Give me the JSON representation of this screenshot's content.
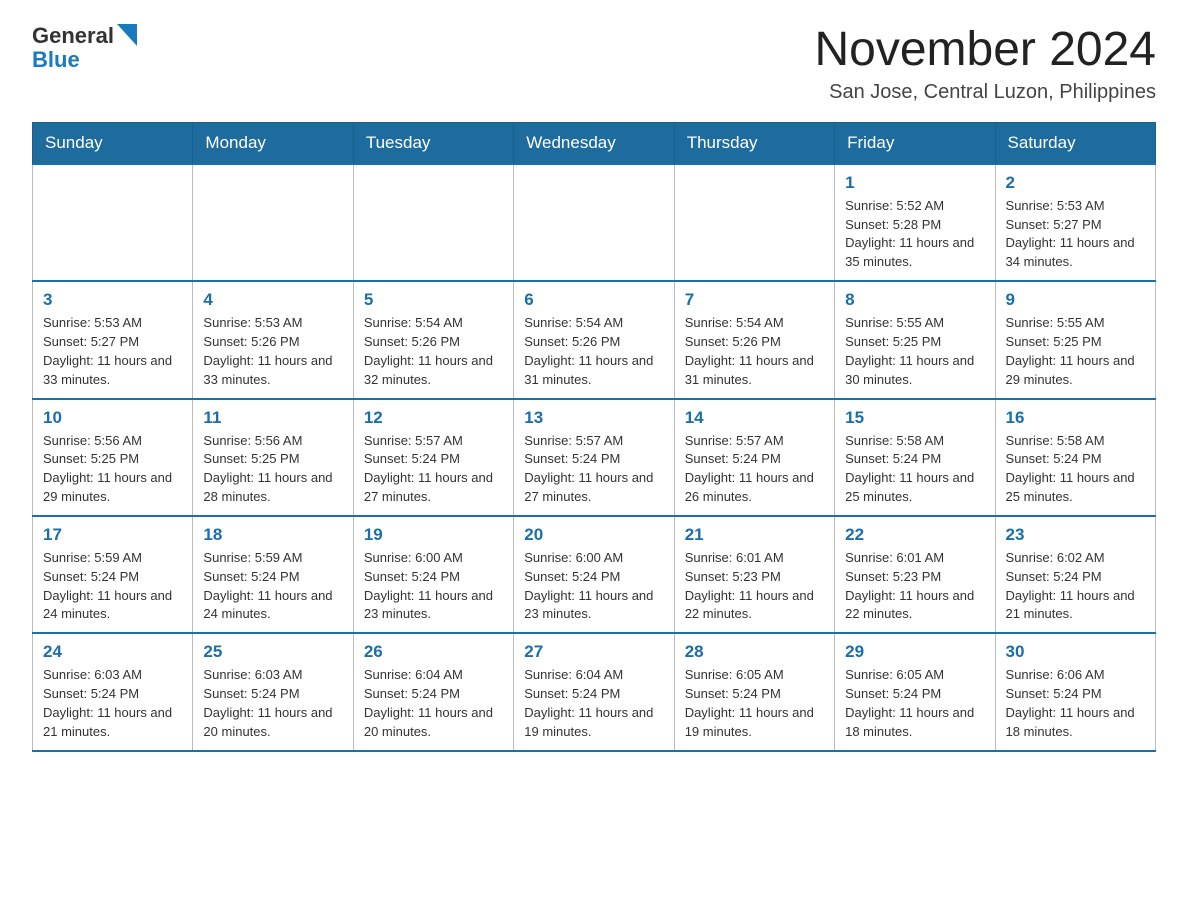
{
  "header": {
    "logo_general": "General",
    "logo_blue": "Blue",
    "month_year": "November 2024",
    "location": "San Jose, Central Luzon, Philippines"
  },
  "weekdays": [
    "Sunday",
    "Monday",
    "Tuesday",
    "Wednesday",
    "Thursday",
    "Friday",
    "Saturday"
  ],
  "weeks": [
    [
      {
        "day": "",
        "info": ""
      },
      {
        "day": "",
        "info": ""
      },
      {
        "day": "",
        "info": ""
      },
      {
        "day": "",
        "info": ""
      },
      {
        "day": "",
        "info": ""
      },
      {
        "day": "1",
        "info": "Sunrise: 5:52 AM\nSunset: 5:28 PM\nDaylight: 11 hours and 35 minutes."
      },
      {
        "day": "2",
        "info": "Sunrise: 5:53 AM\nSunset: 5:27 PM\nDaylight: 11 hours and 34 minutes."
      }
    ],
    [
      {
        "day": "3",
        "info": "Sunrise: 5:53 AM\nSunset: 5:27 PM\nDaylight: 11 hours and 33 minutes."
      },
      {
        "day": "4",
        "info": "Sunrise: 5:53 AM\nSunset: 5:26 PM\nDaylight: 11 hours and 33 minutes."
      },
      {
        "day": "5",
        "info": "Sunrise: 5:54 AM\nSunset: 5:26 PM\nDaylight: 11 hours and 32 minutes."
      },
      {
        "day": "6",
        "info": "Sunrise: 5:54 AM\nSunset: 5:26 PM\nDaylight: 11 hours and 31 minutes."
      },
      {
        "day": "7",
        "info": "Sunrise: 5:54 AM\nSunset: 5:26 PM\nDaylight: 11 hours and 31 minutes."
      },
      {
        "day": "8",
        "info": "Sunrise: 5:55 AM\nSunset: 5:25 PM\nDaylight: 11 hours and 30 minutes."
      },
      {
        "day": "9",
        "info": "Sunrise: 5:55 AM\nSunset: 5:25 PM\nDaylight: 11 hours and 29 minutes."
      }
    ],
    [
      {
        "day": "10",
        "info": "Sunrise: 5:56 AM\nSunset: 5:25 PM\nDaylight: 11 hours and 29 minutes."
      },
      {
        "day": "11",
        "info": "Sunrise: 5:56 AM\nSunset: 5:25 PM\nDaylight: 11 hours and 28 minutes."
      },
      {
        "day": "12",
        "info": "Sunrise: 5:57 AM\nSunset: 5:24 PM\nDaylight: 11 hours and 27 minutes."
      },
      {
        "day": "13",
        "info": "Sunrise: 5:57 AM\nSunset: 5:24 PM\nDaylight: 11 hours and 27 minutes."
      },
      {
        "day": "14",
        "info": "Sunrise: 5:57 AM\nSunset: 5:24 PM\nDaylight: 11 hours and 26 minutes."
      },
      {
        "day": "15",
        "info": "Sunrise: 5:58 AM\nSunset: 5:24 PM\nDaylight: 11 hours and 25 minutes."
      },
      {
        "day": "16",
        "info": "Sunrise: 5:58 AM\nSunset: 5:24 PM\nDaylight: 11 hours and 25 minutes."
      }
    ],
    [
      {
        "day": "17",
        "info": "Sunrise: 5:59 AM\nSunset: 5:24 PM\nDaylight: 11 hours and 24 minutes."
      },
      {
        "day": "18",
        "info": "Sunrise: 5:59 AM\nSunset: 5:24 PM\nDaylight: 11 hours and 24 minutes."
      },
      {
        "day": "19",
        "info": "Sunrise: 6:00 AM\nSunset: 5:24 PM\nDaylight: 11 hours and 23 minutes."
      },
      {
        "day": "20",
        "info": "Sunrise: 6:00 AM\nSunset: 5:24 PM\nDaylight: 11 hours and 23 minutes."
      },
      {
        "day": "21",
        "info": "Sunrise: 6:01 AM\nSunset: 5:23 PM\nDaylight: 11 hours and 22 minutes."
      },
      {
        "day": "22",
        "info": "Sunrise: 6:01 AM\nSunset: 5:23 PM\nDaylight: 11 hours and 22 minutes."
      },
      {
        "day": "23",
        "info": "Sunrise: 6:02 AM\nSunset: 5:24 PM\nDaylight: 11 hours and 21 minutes."
      }
    ],
    [
      {
        "day": "24",
        "info": "Sunrise: 6:03 AM\nSunset: 5:24 PM\nDaylight: 11 hours and 21 minutes."
      },
      {
        "day": "25",
        "info": "Sunrise: 6:03 AM\nSunset: 5:24 PM\nDaylight: 11 hours and 20 minutes."
      },
      {
        "day": "26",
        "info": "Sunrise: 6:04 AM\nSunset: 5:24 PM\nDaylight: 11 hours and 20 minutes."
      },
      {
        "day": "27",
        "info": "Sunrise: 6:04 AM\nSunset: 5:24 PM\nDaylight: 11 hours and 19 minutes."
      },
      {
        "day": "28",
        "info": "Sunrise: 6:05 AM\nSunset: 5:24 PM\nDaylight: 11 hours and 19 minutes."
      },
      {
        "day": "29",
        "info": "Sunrise: 6:05 AM\nSunset: 5:24 PM\nDaylight: 11 hours and 18 minutes."
      },
      {
        "day": "30",
        "info": "Sunrise: 6:06 AM\nSunset: 5:24 PM\nDaylight: 11 hours and 18 minutes."
      }
    ]
  ]
}
